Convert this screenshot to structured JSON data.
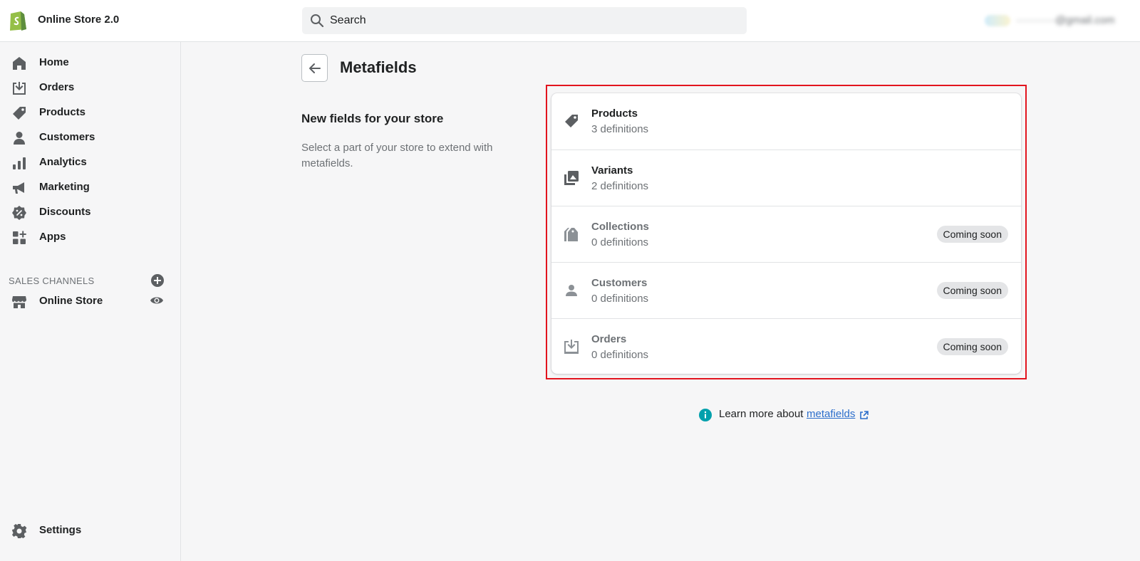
{
  "topbar": {
    "store_name": "Online Store 2.0",
    "search_placeholder": "Search",
    "account_email": "···········@gmail.com"
  },
  "sidebar": {
    "items": [
      {
        "label": "Home",
        "icon": "home-icon"
      },
      {
        "label": "Orders",
        "icon": "orders-icon"
      },
      {
        "label": "Products",
        "icon": "tag-icon"
      },
      {
        "label": "Customers",
        "icon": "person-icon"
      },
      {
        "label": "Analytics",
        "icon": "bar-chart-icon"
      },
      {
        "label": "Marketing",
        "icon": "megaphone-icon"
      },
      {
        "label": "Discounts",
        "icon": "discount-icon"
      },
      {
        "label": "Apps",
        "icon": "apps-icon"
      }
    ],
    "sales_channels_title": "SALES CHANNELS",
    "channels": [
      {
        "label": "Online Store",
        "icon": "store-icon"
      }
    ],
    "settings_label": "Settings"
  },
  "main": {
    "page_title": "Metafields",
    "section_heading": "New fields for your store",
    "section_description": "Select a part of your store to extend with metafields.",
    "rows": [
      {
        "title": "Products",
        "subtitle": "3 definitions",
        "badge": "",
        "icon": "tag-icon"
      },
      {
        "title": "Variants",
        "subtitle": "2 definitions",
        "badge": "",
        "icon": "variants-icon"
      },
      {
        "title": "Collections",
        "subtitle": "0 definitions",
        "badge": "Coming soon",
        "icon": "collections-icon"
      },
      {
        "title": "Customers",
        "subtitle": "0 definitions",
        "badge": "Coming soon",
        "icon": "person-icon"
      },
      {
        "title": "Orders",
        "subtitle": "0 definitions",
        "badge": "Coming soon",
        "icon": "orders-icon"
      }
    ],
    "learn_more_text": "Learn more about",
    "learn_more_link": "metafields"
  },
  "colors": {
    "accent_link": "#2c6ecb",
    "highlight_border": "#e2141e",
    "info_icon": "#00a0ac",
    "shopify_green": "#95bf47"
  }
}
